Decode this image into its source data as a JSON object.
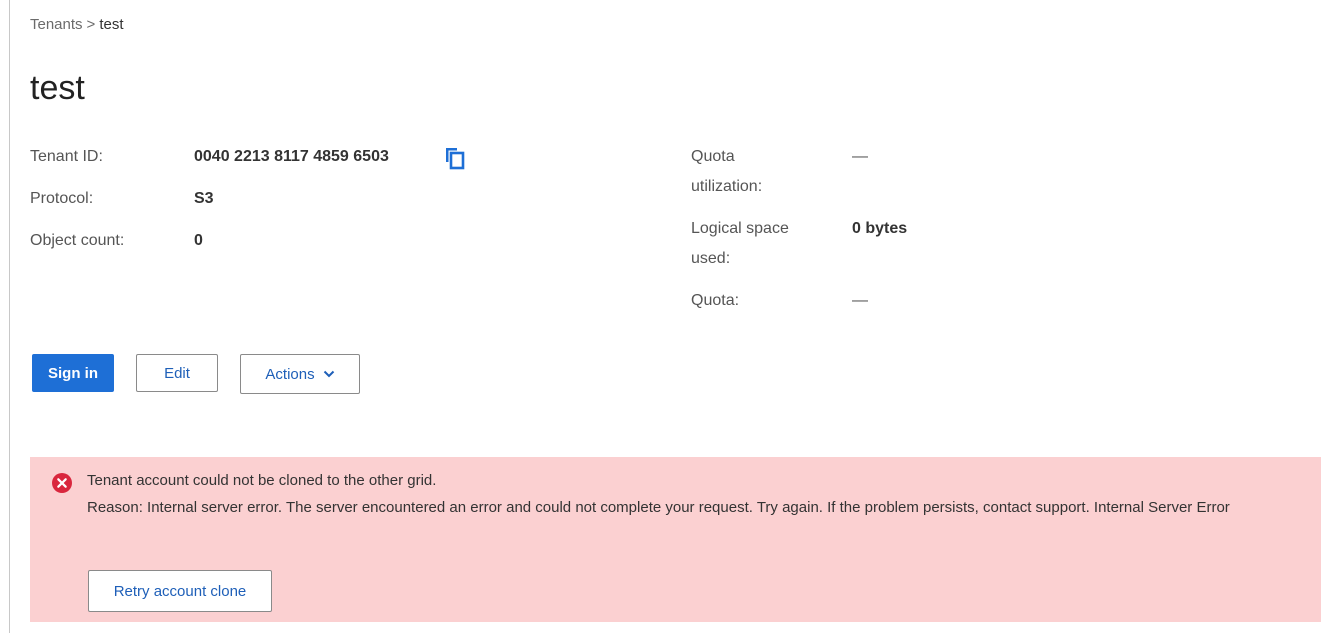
{
  "breadcrumb": {
    "parent": "Tenants",
    "separator": ">",
    "current": "test"
  },
  "page": {
    "title": "test"
  },
  "details": {
    "tenant_id": {
      "label": "Tenant ID:",
      "value": "0040 2213 8117 4859 6503",
      "copy_icon": "copy-icon"
    },
    "protocol": {
      "label": "Protocol:",
      "value": "S3"
    },
    "object_count": {
      "label": "Object count:",
      "value": "0"
    },
    "quota_utilization": {
      "label_line1": "Quota",
      "label_line2": "utilization:",
      "value": "—"
    },
    "logical_space_used": {
      "label_line1": "Logical space",
      "label_line2": "used:",
      "value": "0 bytes"
    },
    "quota": {
      "label": "Quota:",
      "value": "—"
    }
  },
  "buttons": {
    "sign_in": "Sign in",
    "edit": "Edit",
    "actions": "Actions"
  },
  "alert": {
    "icon": "error-circle-icon",
    "title": "Tenant account could not be cloned to the other grid.",
    "reason": "Reason: Internal server error. The server encountered an error and could not complete your request. Try again. If the problem persists, contact support. Internal Server Error",
    "retry_label": "Retry account clone"
  },
  "colors": {
    "primary": "#1e6fd6",
    "link": "#1e5fb8",
    "alert_background": "#fbd0d1",
    "error_red": "#d9263d"
  }
}
